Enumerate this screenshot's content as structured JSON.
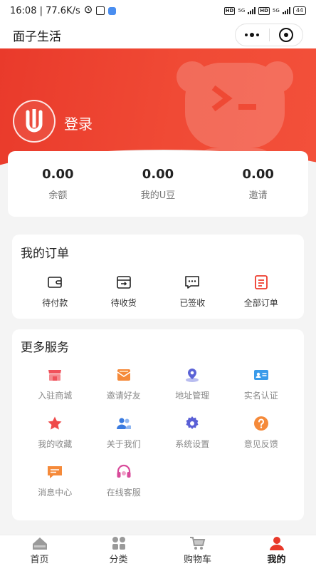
{
  "status_bar": {
    "time_speed": "16:08 | 77.6K/s",
    "battery": "44",
    "network_labels": [
      "HD",
      "5G",
      "HD",
      "5G"
    ]
  },
  "header": {
    "title": "面子生活"
  },
  "profile": {
    "login_label": "登录"
  },
  "balances": [
    {
      "value": "0.00",
      "label": "余额"
    },
    {
      "value": "0.00",
      "label": "我的U豆"
    },
    {
      "value": "0.00",
      "label": "邀请"
    }
  ],
  "orders": {
    "title": "我的订单",
    "items": [
      {
        "label": "待付款",
        "icon": "wallet-icon"
      },
      {
        "label": "待收货",
        "icon": "delivery-box-icon"
      },
      {
        "label": "已签收",
        "icon": "message-dots-icon"
      },
      {
        "label": "全部订单",
        "icon": "document-list-icon"
      }
    ]
  },
  "services": {
    "title": "更多服务",
    "items": [
      {
        "label": "入驻商城",
        "icon": "store-icon",
        "color": "#f0525c"
      },
      {
        "label": "邀请好友",
        "icon": "envelope-icon",
        "color": "#f58a3a"
      },
      {
        "label": "地址管理",
        "icon": "location-pin-icon",
        "color": "#5b63d6"
      },
      {
        "label": "实名认证",
        "icon": "id-card-icon",
        "color": "#3a9bea"
      },
      {
        "label": "我的收藏",
        "icon": "star-icon",
        "color": "#ef4a4a"
      },
      {
        "label": "关于我们",
        "icon": "users-icon",
        "color": "#3a7be0"
      },
      {
        "label": "系统设置",
        "icon": "gear-icon",
        "color": "#5a5fd6"
      },
      {
        "label": "意见反馈",
        "icon": "question-icon",
        "color": "#f58a3a"
      },
      {
        "label": "消息中心",
        "icon": "chat-bubble-icon",
        "color": "#f58a3a"
      },
      {
        "label": "在线客服",
        "icon": "headset-icon",
        "color": "#d84a9a"
      }
    ]
  },
  "nav": {
    "items": [
      {
        "label": "首页",
        "icon": "home-icon"
      },
      {
        "label": "分类",
        "icon": "category-grid-icon"
      },
      {
        "label": "购物车",
        "icon": "cart-icon"
      },
      {
        "label": "我的",
        "icon": "profile-icon",
        "active": true
      }
    ]
  },
  "colors": {
    "brand_red": "#ee4330",
    "active_nav": "#e8392a"
  }
}
